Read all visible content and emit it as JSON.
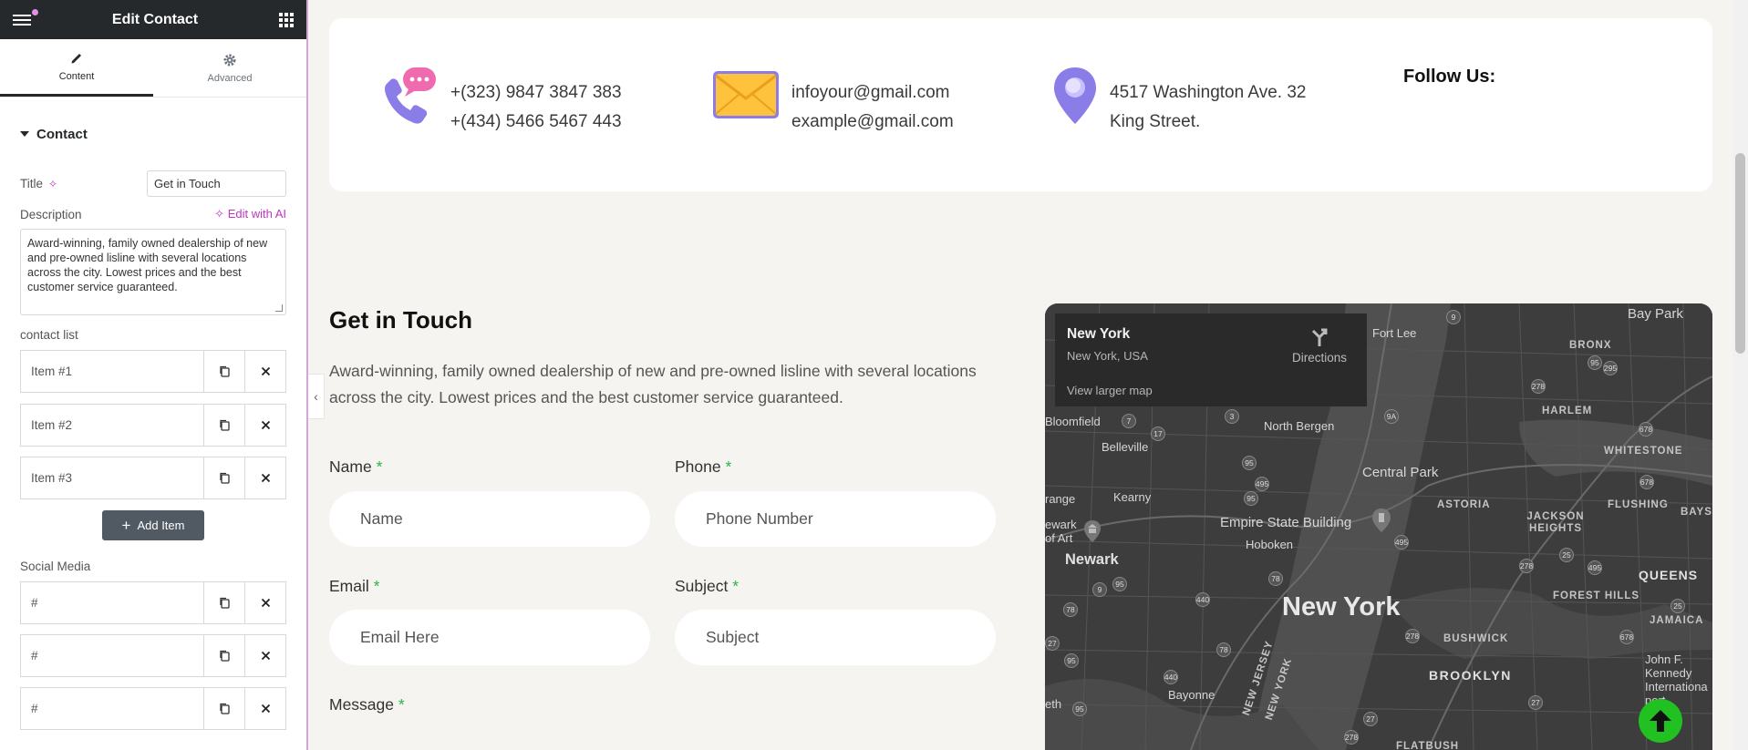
{
  "panel": {
    "title": "Edit Contact",
    "tabs": [
      {
        "label": "Content",
        "icon": "pencil-icon"
      },
      {
        "label": "Advanced",
        "icon": "gear-icon"
      }
    ],
    "section": "Contact",
    "title_label": "Title",
    "title_value": "Get in Touch",
    "description_label": "Description",
    "edit_ai_label": "Edit with AI",
    "description_value": "Award-winning, family owned dealership of new and pre-owned lisline with several locations across the city. Lowest prices and the best customer service guaranteed.",
    "contact_list_label": "contact list",
    "contact_items": [
      "Item #1",
      "Item #2",
      "Item #3"
    ],
    "add_item_label": "Add Item",
    "social_label": "Social Media",
    "social_items": [
      "#",
      "#",
      "#"
    ]
  },
  "info": {
    "phones": [
      "+(323) 9847 3847 383",
      "+(434) 5466 5467 443"
    ],
    "emails": [
      "infoyour@gmail.com",
      "example@gmail.com"
    ],
    "address": [
      "4517 Washington Ave. 32",
      "King Street."
    ],
    "follow_label": "Follow Us:"
  },
  "contact": {
    "title": "Get in Touch",
    "description": "Award-winning, family owned dealership of new and pre-owned lisline with several locations across the city. Lowest prices and the best customer service guaranteed.",
    "required_mark": "*",
    "fields": {
      "name": {
        "label": "Name",
        "placeholder": "Name"
      },
      "phone": {
        "label": "Phone",
        "placeholder": "Phone Number"
      },
      "email": {
        "label": "Email",
        "placeholder": "Email Here"
      },
      "subject": {
        "label": "Subject",
        "placeholder": "Subject"
      },
      "message": {
        "label": "Message"
      }
    }
  },
  "map": {
    "place": "New York",
    "address": "New York, USA",
    "directions_label": "Directions",
    "larger_map_label": "View larger map",
    "labels": {
      "fort_lee": "Fort Lee",
      "bay_park": "Bay Park",
      "bronx": "BRONX",
      "harlem": "HARLEM",
      "whitestone": "WHITESTONE",
      "bayside": "BAYSID",
      "bloomfield": "Bloomfield",
      "belleville": "Belleville",
      "north_bergen": "North Bergen",
      "central_park": "Central Park",
      "astoria": "ASTORIA",
      "flushing": "FLUSHING",
      "jackson_heights": "JACKSON HEIGHTS",
      "kearny": "Kearny",
      "orange": "range",
      "empire": "Empire State Building",
      "newark_of_art": "ewark\nof Art",
      "hoboken": "Hoboken",
      "newark": "Newark",
      "queens": "QUEENS",
      "forest_hills": "FOREST HILLS",
      "jamaica": "JAMAICA",
      "new_york": "New York",
      "bushwick": "BUSHWICK",
      "new_jersey": "NEW JERSEY",
      "new_york_diag": "NEW YORK",
      "brooklyn": "BROOKLYN",
      "jfk": "John F.\nKennedy\nInternationa\nport",
      "bayonne": "Bayonne",
      "eth": "eth",
      "flatbush": "FLATBUSH"
    }
  },
  "colors": {
    "accent_pink": "#c036c0",
    "required_green": "#2bb34a",
    "scroll_top_green": "#20c120",
    "panel_dark": "#26292c"
  }
}
